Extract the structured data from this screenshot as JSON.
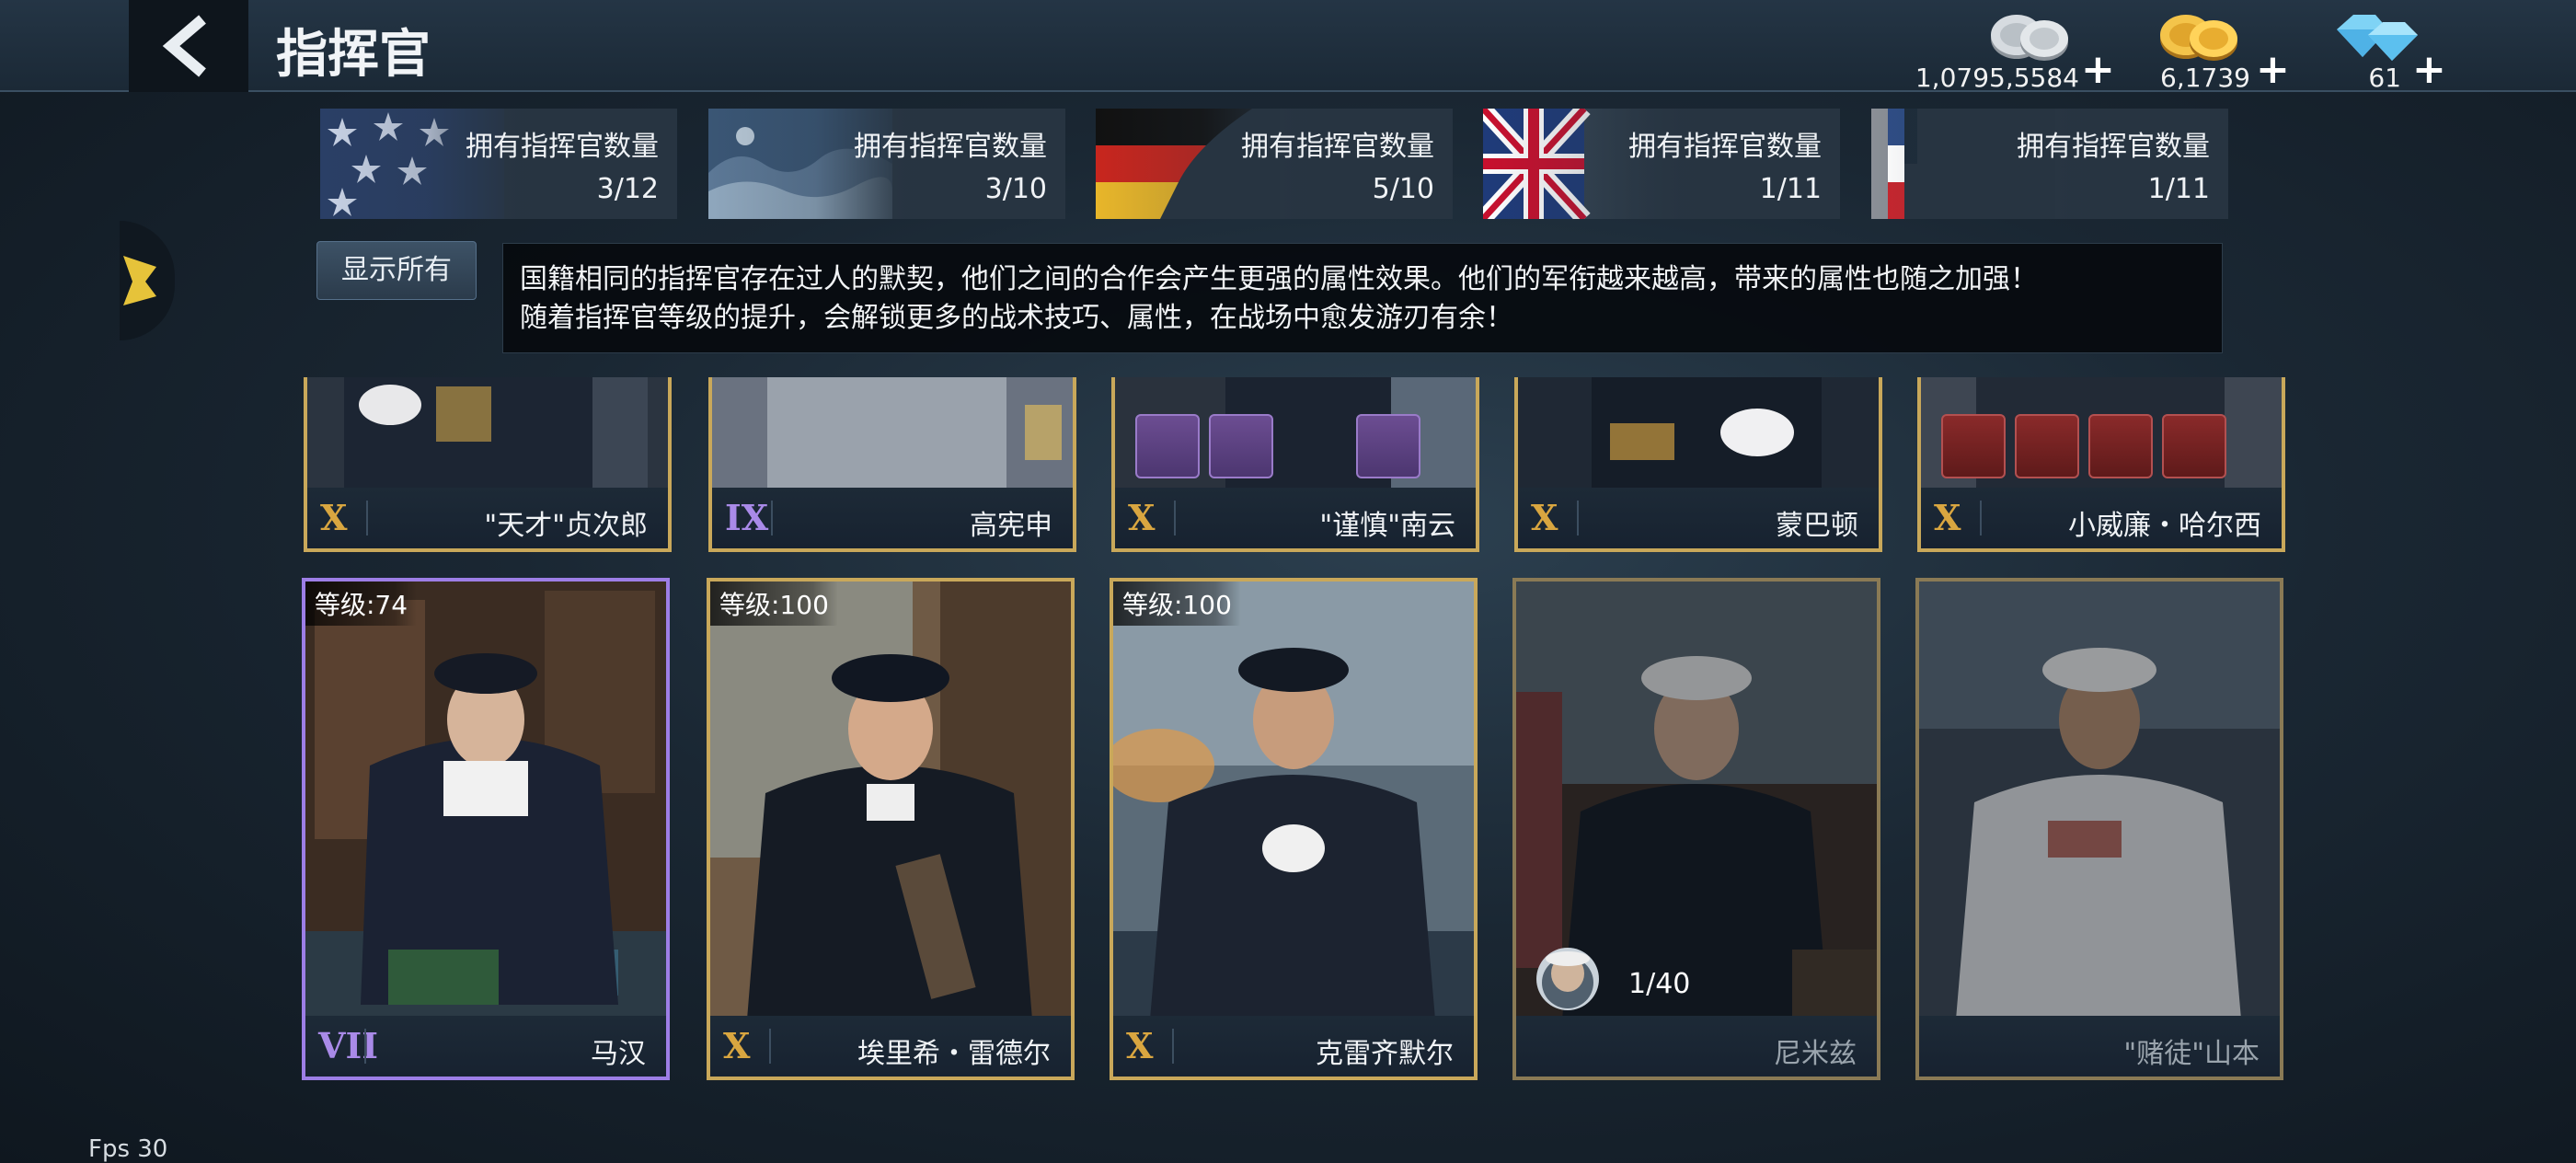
{
  "header": {
    "title": "指挥官",
    "back_icon": "chevron-left-icon"
  },
  "currencies": [
    {
      "name": "silver",
      "icon": "silver-coins-icon",
      "amount": "1,0795,5584",
      "plus": "+"
    },
    {
      "name": "gold",
      "icon": "gold-coins-icon",
      "amount": "6,1739",
      "plus": "+"
    },
    {
      "name": "diamond",
      "icon": "diamond-icon",
      "amount": "61",
      "plus": "+"
    }
  ],
  "nation_tabs": [
    {
      "nation": "usa",
      "label": "拥有指挥官数量",
      "count": "3/12"
    },
    {
      "nation": "japan",
      "label": "拥有指挥官数量",
      "count": "3/10"
    },
    {
      "nation": "germany",
      "label": "拥有指挥官数量",
      "count": "5/10"
    },
    {
      "nation": "uk",
      "label": "拥有指挥官数量",
      "count": "1/11"
    },
    {
      "nation": "other",
      "label": "拥有指挥官数量",
      "count": "1/11"
    }
  ],
  "show_all_label": "显示所有",
  "info_text": {
    "line1": "国籍相同的指挥官存在过人的默契，他们之间的合作会产生更强的属性效果。他们的军衔越来越高，带来的属性也随之加强！",
    "line2": "随着指挥官等级的提升，会解锁更多的战术技巧、属性，在战场中愈发游刃有余！"
  },
  "commanders_top": [
    {
      "rank": "X",
      "name": "\"天才\"贞次郎",
      "items": []
    },
    {
      "rank": "IX",
      "name": "高宪申",
      "items": []
    },
    {
      "rank": "X",
      "name": "\"谨慎\"南云",
      "items": [
        "medal-ribbon-icon",
        "dagger-icon",
        "telescope-icon"
      ]
    },
    {
      "rank": "X",
      "name": "蒙巴顿",
      "items": []
    },
    {
      "rank": "X",
      "name": "小威廉・哈尔西",
      "items": [
        "epaulette-icon",
        "sword-icon",
        "uniform-icon",
        "dagger-icon"
      ]
    }
  ],
  "commanders_bottom": [
    {
      "rank": "VII",
      "name": "马汉",
      "level": "等级:74",
      "owned": true
    },
    {
      "rank": "X",
      "name": "埃里希・雷德尔",
      "level": "等级:100",
      "owned": true
    },
    {
      "rank": "X",
      "name": "克雷齐默尔",
      "level": "等级:100",
      "owned": true
    },
    {
      "rank": "",
      "name": "尼米兹",
      "level": "",
      "owned": false,
      "fragments": "1/40"
    },
    {
      "rank": "",
      "name": "\"赌徒\"山本",
      "level": "",
      "owned": false
    }
  ],
  "fps": "Fps 30"
}
